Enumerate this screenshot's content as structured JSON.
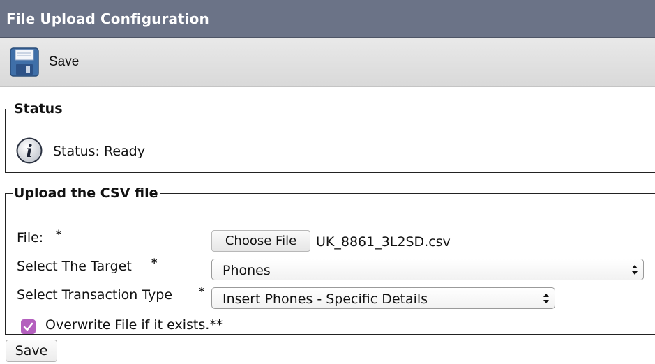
{
  "header": {
    "title": "File Upload Configuration"
  },
  "toolbar": {
    "save_label": "Save",
    "save_icon": "floppy-disk-icon"
  },
  "status": {
    "legend": "Status",
    "icon": "info-icon",
    "text": "Status: Ready"
  },
  "upload": {
    "legend": "Upload the CSV file",
    "required_mark": "*",
    "file": {
      "label": "File:",
      "button_label": "Choose File",
      "filename": "UK_8861_3L2SD.csv"
    },
    "target": {
      "label": "Select The Target",
      "value": "Phones"
    },
    "transaction": {
      "label": "Select Transaction Type",
      "value": "Insert Phones - Specific Details"
    },
    "overwrite": {
      "label": "Overwrite File if it exists.**",
      "checked": true,
      "check_color": "#b45fbe"
    }
  },
  "footer": {
    "save_label": "Save"
  },
  "colors": {
    "title_bar": "#6b7387",
    "toolbar_bg": "#e1e1e1"
  }
}
